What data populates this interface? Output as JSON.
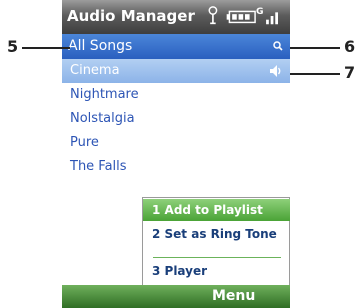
{
  "title_bar": {
    "title": "Audio Manager",
    "icons": [
      "antenna-icon",
      "battery-icon",
      "gprs-signal-icon"
    ],
    "gprs_label": "G"
  },
  "header": {
    "label": "All Songs",
    "search_icon": "search-icon"
  },
  "songs": [
    "Cinema",
    "Nightmare",
    "Nolstalgia",
    "Pure",
    "The Falls"
  ],
  "selected_song_index": 0,
  "selected_row_icon": "speaker-icon",
  "context_menu": {
    "items": [
      {
        "label": "1 Add to Playlist",
        "highlighted": true
      },
      {
        "label": "2 Set as Ring Tone",
        "highlighted": false
      },
      {
        "label": "3 Player",
        "highlighted": false
      }
    ]
  },
  "softkeys": {
    "right": "Menu"
  },
  "callouts": {
    "five": "5",
    "six": "6",
    "seven": "7"
  },
  "colors": {
    "title_bar": "#4a4a4a",
    "header_blue": "#3a73cf",
    "selected_row": "#a2c3ee",
    "list_text": "#2d55b5",
    "menu_highlight": "#6bbf55",
    "softkey_bar": "#4a8f3a"
  }
}
